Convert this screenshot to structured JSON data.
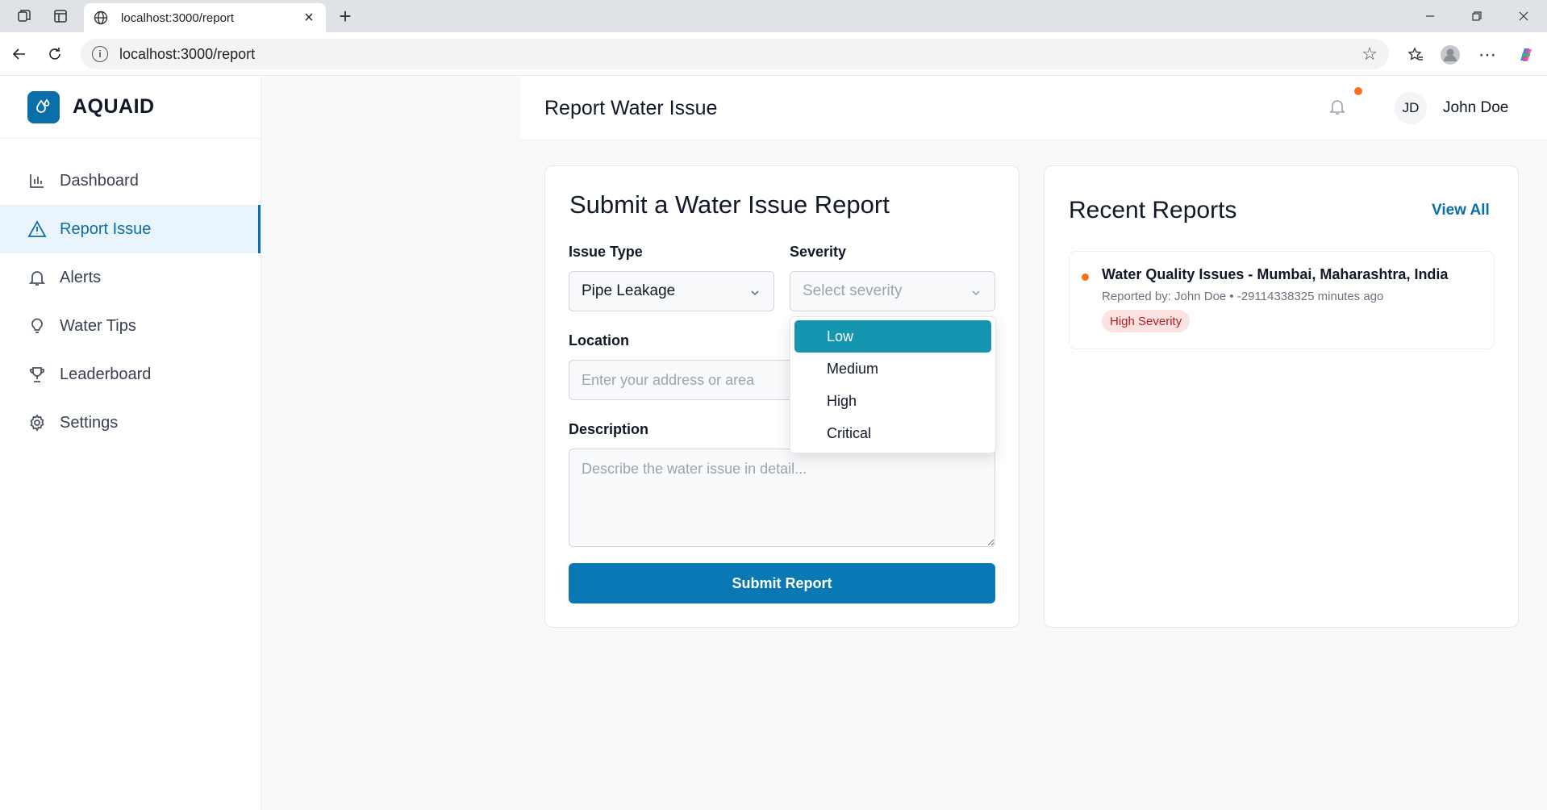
{
  "browser": {
    "tab_title": "localhost:3000/report",
    "url": "localhost:3000/report"
  },
  "sidebar": {
    "brand": "AQUAID",
    "items": [
      {
        "label": "Dashboard",
        "icon": "bar-chart-icon"
      },
      {
        "label": "Report Issue",
        "icon": "warning-icon",
        "active": true
      },
      {
        "label": "Alerts",
        "icon": "bell-icon"
      },
      {
        "label": "Water Tips",
        "icon": "lightbulb-icon"
      },
      {
        "label": "Leaderboard",
        "icon": "trophy-icon"
      },
      {
        "label": "Settings",
        "icon": "gear-icon"
      }
    ]
  },
  "header": {
    "title": "Report Water Issue",
    "avatar_initials": "JD",
    "user_name": "John Doe"
  },
  "form": {
    "title": "Submit a Water Issue Report",
    "issue_type_label": "Issue Type",
    "issue_type_value": "Pipe Leakage",
    "severity_label": "Severity",
    "severity_placeholder": "Select severity",
    "severity_options": [
      "Low",
      "Medium",
      "High",
      "Critical"
    ],
    "severity_highlighted": "Low",
    "location_label": "Location",
    "location_placeholder": "Enter your address or area",
    "description_label": "Description",
    "description_placeholder": "Describe the water issue in detail...",
    "submit_label": "Submit Report"
  },
  "recent": {
    "title": "Recent Reports",
    "view_all": "View All",
    "reports": [
      {
        "title": "Water Quality Issues - Mumbai, Maharashtra, India",
        "meta": "Reported by: John Doe • -29114338325 minutes ago",
        "badge": "High Severity"
      }
    ]
  },
  "colors": {
    "accent": "#0a6fa8",
    "button": "#0a78b4",
    "dropdown_highlight": "#1596b0",
    "status_dot": "#f97316",
    "badge_bg": "#fde2e2",
    "badge_text": "#b91c1c"
  }
}
